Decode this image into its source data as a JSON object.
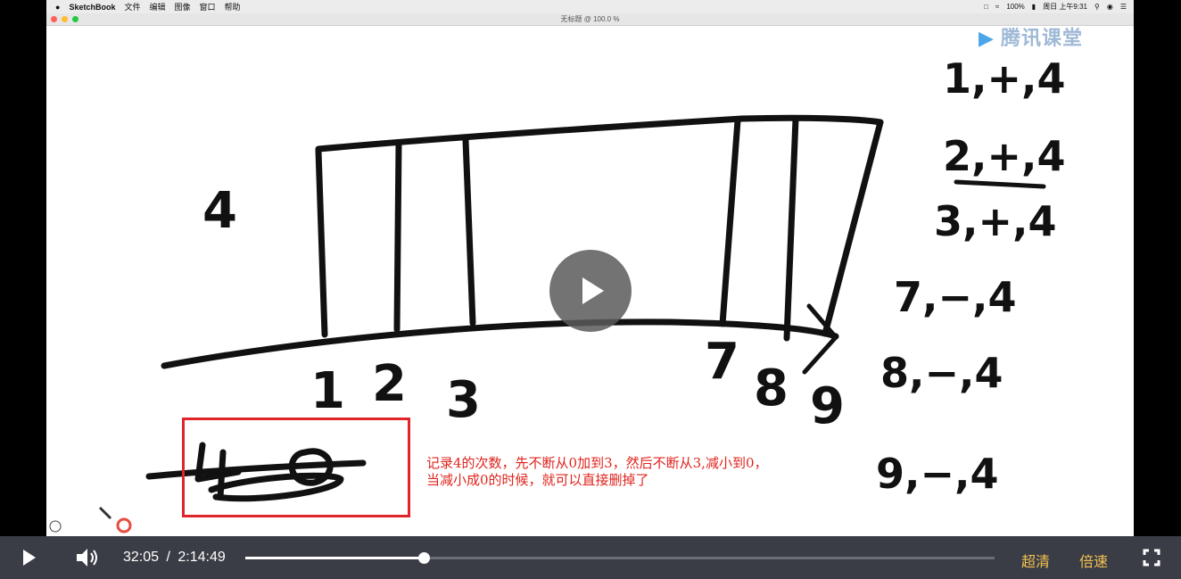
{
  "menubar": {
    "app_name": "SketchBook",
    "menus": [
      "文件",
      "编辑",
      "图像",
      "窗口",
      "帮助"
    ],
    "battery": "100%",
    "clock": "周日 上午9:31"
  },
  "window": {
    "title": "无标题 @ 100.0 %"
  },
  "watermark": "腾讯课堂",
  "sketch": {
    "left_digit": "4",
    "bottom_numbers": [
      "1",
      "2",
      "3",
      "7",
      "8",
      "9"
    ],
    "right_list": [
      "1,+,4",
      "2,+,4",
      "3,+,4",
      "7,−,4",
      "8,−,4",
      "9,−,4"
    ],
    "note_lines": [
      "记录4的次数，先不断从0加到3，然后不断从3,减小到0，",
      "当减小成0的时候，就可以直接删掉了"
    ]
  },
  "player": {
    "current_time": "32:05",
    "separator": "/",
    "duration": "2:14:49",
    "progress": 0.238,
    "quality_label": "超清",
    "speed_label": "倍速"
  },
  "colors": {
    "annotation_red": "#e0241e",
    "control_bar": "#3a3d45",
    "accent_gold": "#f4c152"
  }
}
